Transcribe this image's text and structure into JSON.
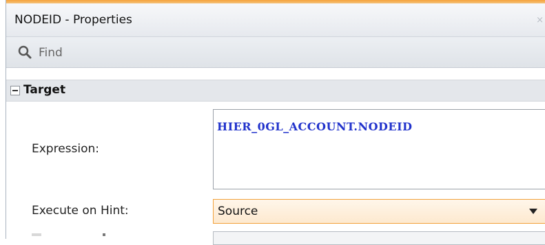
{
  "window": {
    "title": "NODEID - Properties",
    "close_glyph": "×"
  },
  "find": {
    "placeholder": "Find",
    "icon": "search-icon"
  },
  "section": {
    "title": "Target",
    "collapsed": false
  },
  "fields": {
    "expression_label": "Expression:",
    "expression_value": "HIER_0GL_ACCOUNT.NODEID",
    "execute_on_hint_label": "Execute on Hint:",
    "execute_on_hint_value": "Source"
  },
  "colors": {
    "accent": "#f6a33a",
    "expression_text": "#2233cc",
    "select_border": "#f2a13b"
  }
}
